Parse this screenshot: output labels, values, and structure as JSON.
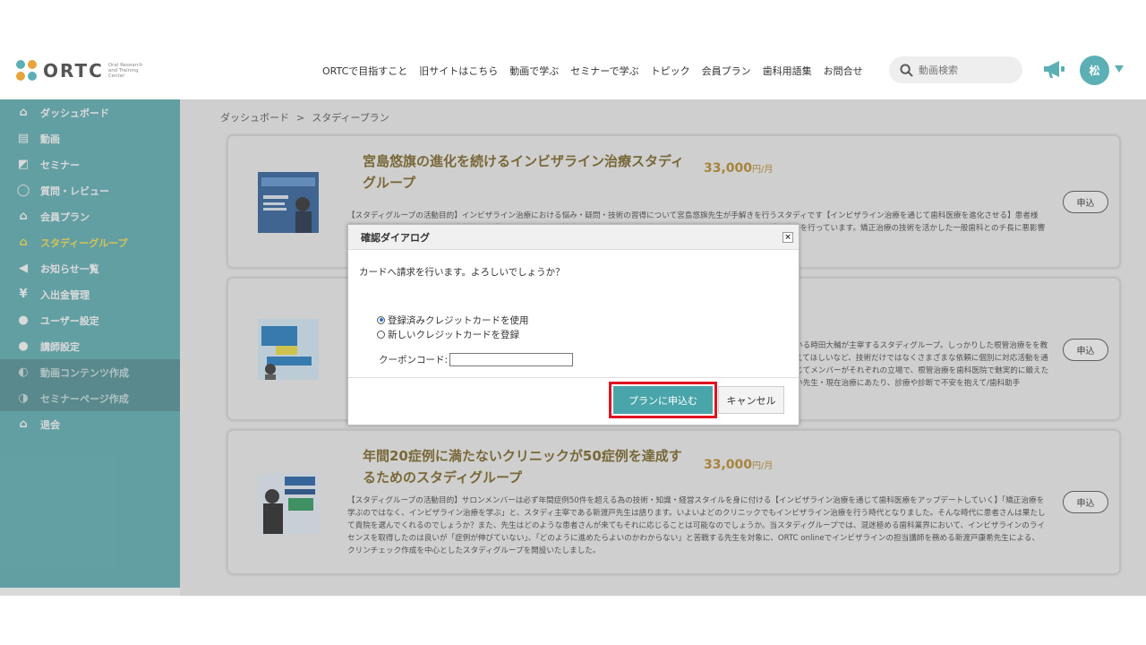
{
  "header": {
    "logo_text": "ORTC",
    "logo_sub": "Oral Research and Training Center",
    "nav": [
      "ORTCで目指すこと",
      "旧サイトはこちら",
      "動画で学ぶ",
      "セミナーで学ぶ",
      "トピック",
      "会員プラン",
      "歯科用語集",
      "お問合せ"
    ],
    "search_placeholder": "動画検索",
    "avatar_text": "松"
  },
  "sidebar": {
    "items": [
      {
        "label": "ダッシュボード",
        "icon": "home-icon"
      },
      {
        "label": "動画",
        "icon": "film-icon"
      },
      {
        "label": "セミナー",
        "icon": "presentation-icon"
      },
      {
        "label": "質問・レビュー",
        "icon": "chat-icon"
      },
      {
        "label": "会員プラン",
        "icon": "home-icon"
      },
      {
        "label": "スタディーグループ",
        "icon": "home-icon"
      },
      {
        "label": "お知らせ一覧",
        "icon": "megaphone-icon"
      },
      {
        "label": "入出金管理",
        "icon": "yen-icon"
      },
      {
        "label": "ユーザー設定",
        "icon": "user-icon"
      },
      {
        "label": "講師設定",
        "icon": "user-icon"
      },
      {
        "label": "動画コンテンツ作成",
        "icon": "video-create-icon"
      },
      {
        "label": "セミナーページ作成",
        "icon": "seminar-create-icon"
      },
      {
        "label": "退会",
        "icon": "home-icon"
      }
    ]
  },
  "breadcrumb": {
    "home": "ダッシュボード",
    "sep": ">",
    "current": "スタディープラン"
  },
  "cards": [
    {
      "title": "宮島悠旗の進化を続けるインビザライン治療スタディグループ",
      "price": "33,000",
      "unit": "円/月",
      "desc": "【スタディグループの活動目的】インビザライン治療における悩み・疑問・技術の習得について宮島悠旗先生が手解きを行うスタディです【インビザライン治療を通じて歯科医療を進化させる】患者様一人ひとりの声に耳を傾け、患者様第一で満足していただける診療と最新の技術で噛み合わせとエステティックに配慮した矯正治療を行っています。矯正治療の技術を活かした一般歯科とのチ長に悪影響を与える生活習慣・歯並びや噛み合わせと健康・矯正治歯を\"磨け\"」、「覚悟の瞬間」に出演するなどメディア業績多数。",
      "apply": "申込"
    },
    {
      "title": "",
      "price": "",
      "unit": "",
      "desc": "いる時田大輔が主宰するスタディグループ。しっかりした根管治療をを教えてほしいなど、技術だけではなくさまざまな依頼に個別に対応活動を通じてメンバーがそれぞれの立場で、根管治療を歯科医院で魅実的に鍛えたい先生・現在治療にあたり、診療や診断で不安を抱えて/歯科助手",
      "apply": "申込"
    },
    {
      "title": "年間20症例に満たないクリニックが50症例を達成するためのスタディグループ",
      "price": "33,000",
      "unit": "円/月",
      "desc": "【スタディグループの活動目的】サロンメンバーは必ず年間症例50件を超える為の技術・知識・経営スタイルを身に付ける【インビザライン治療を通じて歯科医療をアップデートしていく】「矯正治療を学ぶのではなく、インビザライン治療を学ぶ」と、スタディ主宰である新渡戸先生は語ります。いよいよどのクリニックでもインビザライン治療を行う時代となりました。そんな時代に患者さんは果たして貴院を選んでくれるのでしょうか？また、先生はどのような患者さんが来てもそれに応じることは可能なのでしょうか。当スタディグループでは、混迷極める歯科業界において、インビザラインのライセンスを取得したのは良いが「症例が伸びていない」、「どのように進めたらよいのかわからない」と苦戦する先生を対象に、ORTC onlineでインビザラインの担当講師を務める新渡戸康希先生による、クリンチェック作成を中心としたスタディグループを開設いたしました。",
      "apply": "申込"
    }
  ],
  "dialog": {
    "title": "確認ダイアログ",
    "close": "×",
    "message": "カードへ請求を行います。よろしいでしょうか？",
    "options": [
      "登録済みクレジットカードを使用",
      "新しいクレジットカードを登録"
    ],
    "selected_option": "登録済みクレジットカードを使用",
    "coupon_label": "クーポンコード:",
    "coupon_value": "",
    "confirm": "プランに申込む",
    "cancel": "キャンセル"
  },
  "colors": {
    "teal": "#5bafb5",
    "active": "#f5e04a",
    "gold": "#b98a28",
    "highlight": "#e0131f"
  }
}
